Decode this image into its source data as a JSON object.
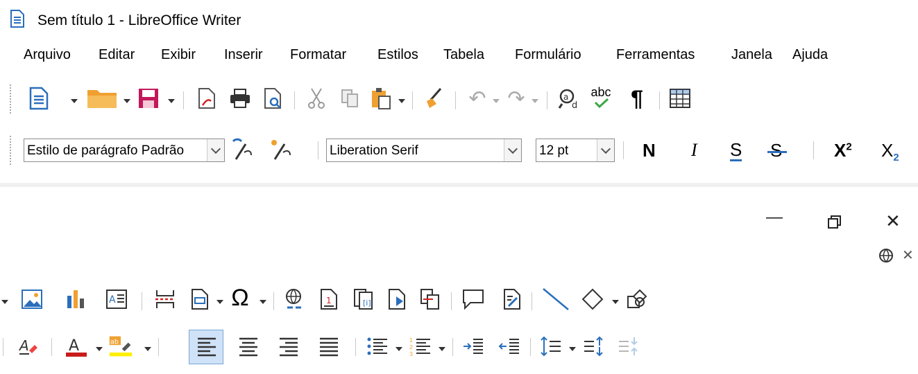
{
  "window": {
    "title": "Sem título 1 - LibreOffice Writer"
  },
  "menubar": {
    "items": [
      {
        "label": "Arquivo"
      },
      {
        "label": "Editar"
      },
      {
        "label": "Exibir"
      },
      {
        "label": "Inserir"
      },
      {
        "label": "Formatar"
      },
      {
        "label": "Estilos"
      },
      {
        "label": "Tabela"
      },
      {
        "label": "Formulário"
      },
      {
        "label": "Ferramentas"
      },
      {
        "label": "Janela"
      },
      {
        "label": "Ajuda"
      }
    ]
  },
  "formatting": {
    "paragraph_style": "Estilo de parágrafo Padrão",
    "font_name": "Liberation Serif",
    "font_size": "12 pt",
    "bold_label": "N",
    "italic_label": "I",
    "underline_label": "S",
    "strike_label": "S",
    "superscript_base": "X",
    "superscript_exp": "2",
    "subscript_base": "X",
    "subscript_idx": "2",
    "spell_check_label": "abc"
  },
  "icons": {
    "pilcrow": "¶",
    "special_char": "Ω",
    "close_glyph": "✕",
    "minimize_glyph": "—",
    "undo": "↶",
    "redo": "↷"
  },
  "colors": {
    "accent_blue": "#2a6ebb",
    "orange": "#f0a030",
    "red": "#d42020",
    "font_color_bar": "#c81c1c",
    "highlight_bar": "#ffee00",
    "active_align_bg": "#cfe2f7"
  }
}
